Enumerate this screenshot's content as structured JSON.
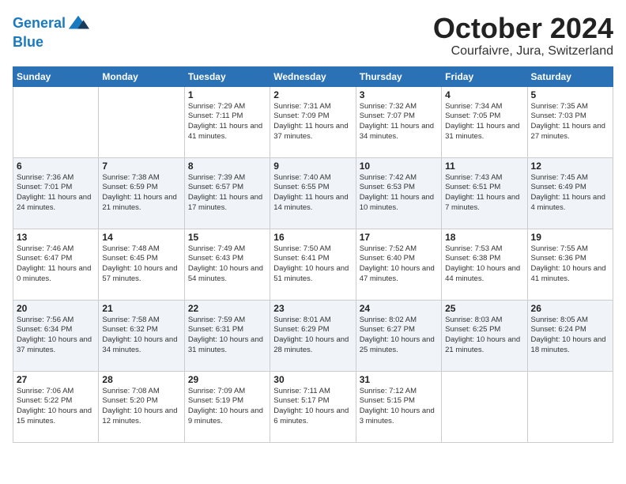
{
  "header": {
    "logo_line1": "General",
    "logo_line2": "Blue",
    "month": "October 2024",
    "location": "Courfaivre, Jura, Switzerland"
  },
  "weekdays": [
    "Sunday",
    "Monday",
    "Tuesday",
    "Wednesday",
    "Thursday",
    "Friday",
    "Saturday"
  ],
  "weeks": [
    [
      {
        "day": "",
        "info": ""
      },
      {
        "day": "",
        "info": ""
      },
      {
        "day": "1",
        "info": "Sunrise: 7:29 AM\nSunset: 7:11 PM\nDaylight: 11 hours and 41 minutes."
      },
      {
        "day": "2",
        "info": "Sunrise: 7:31 AM\nSunset: 7:09 PM\nDaylight: 11 hours and 37 minutes."
      },
      {
        "day": "3",
        "info": "Sunrise: 7:32 AM\nSunset: 7:07 PM\nDaylight: 11 hours and 34 minutes."
      },
      {
        "day": "4",
        "info": "Sunrise: 7:34 AM\nSunset: 7:05 PM\nDaylight: 11 hours and 31 minutes."
      },
      {
        "day": "5",
        "info": "Sunrise: 7:35 AM\nSunset: 7:03 PM\nDaylight: 11 hours and 27 minutes."
      }
    ],
    [
      {
        "day": "6",
        "info": "Sunrise: 7:36 AM\nSunset: 7:01 PM\nDaylight: 11 hours and 24 minutes."
      },
      {
        "day": "7",
        "info": "Sunrise: 7:38 AM\nSunset: 6:59 PM\nDaylight: 11 hours and 21 minutes."
      },
      {
        "day": "8",
        "info": "Sunrise: 7:39 AM\nSunset: 6:57 PM\nDaylight: 11 hours and 17 minutes."
      },
      {
        "day": "9",
        "info": "Sunrise: 7:40 AM\nSunset: 6:55 PM\nDaylight: 11 hours and 14 minutes."
      },
      {
        "day": "10",
        "info": "Sunrise: 7:42 AM\nSunset: 6:53 PM\nDaylight: 11 hours and 10 minutes."
      },
      {
        "day": "11",
        "info": "Sunrise: 7:43 AM\nSunset: 6:51 PM\nDaylight: 11 hours and 7 minutes."
      },
      {
        "day": "12",
        "info": "Sunrise: 7:45 AM\nSunset: 6:49 PM\nDaylight: 11 hours and 4 minutes."
      }
    ],
    [
      {
        "day": "13",
        "info": "Sunrise: 7:46 AM\nSunset: 6:47 PM\nDaylight: 11 hours and 0 minutes."
      },
      {
        "day": "14",
        "info": "Sunrise: 7:48 AM\nSunset: 6:45 PM\nDaylight: 10 hours and 57 minutes."
      },
      {
        "day": "15",
        "info": "Sunrise: 7:49 AM\nSunset: 6:43 PM\nDaylight: 10 hours and 54 minutes."
      },
      {
        "day": "16",
        "info": "Sunrise: 7:50 AM\nSunset: 6:41 PM\nDaylight: 10 hours and 51 minutes."
      },
      {
        "day": "17",
        "info": "Sunrise: 7:52 AM\nSunset: 6:40 PM\nDaylight: 10 hours and 47 minutes."
      },
      {
        "day": "18",
        "info": "Sunrise: 7:53 AM\nSunset: 6:38 PM\nDaylight: 10 hours and 44 minutes."
      },
      {
        "day": "19",
        "info": "Sunrise: 7:55 AM\nSunset: 6:36 PM\nDaylight: 10 hours and 41 minutes."
      }
    ],
    [
      {
        "day": "20",
        "info": "Sunrise: 7:56 AM\nSunset: 6:34 PM\nDaylight: 10 hours and 37 minutes."
      },
      {
        "day": "21",
        "info": "Sunrise: 7:58 AM\nSunset: 6:32 PM\nDaylight: 10 hours and 34 minutes."
      },
      {
        "day": "22",
        "info": "Sunrise: 7:59 AM\nSunset: 6:31 PM\nDaylight: 10 hours and 31 minutes."
      },
      {
        "day": "23",
        "info": "Sunrise: 8:01 AM\nSunset: 6:29 PM\nDaylight: 10 hours and 28 minutes."
      },
      {
        "day": "24",
        "info": "Sunrise: 8:02 AM\nSunset: 6:27 PM\nDaylight: 10 hours and 25 minutes."
      },
      {
        "day": "25",
        "info": "Sunrise: 8:03 AM\nSunset: 6:25 PM\nDaylight: 10 hours and 21 minutes."
      },
      {
        "day": "26",
        "info": "Sunrise: 8:05 AM\nSunset: 6:24 PM\nDaylight: 10 hours and 18 minutes."
      }
    ],
    [
      {
        "day": "27",
        "info": "Sunrise: 7:06 AM\nSunset: 5:22 PM\nDaylight: 10 hours and 15 minutes."
      },
      {
        "day": "28",
        "info": "Sunrise: 7:08 AM\nSunset: 5:20 PM\nDaylight: 10 hours and 12 minutes."
      },
      {
        "day": "29",
        "info": "Sunrise: 7:09 AM\nSunset: 5:19 PM\nDaylight: 10 hours and 9 minutes."
      },
      {
        "day": "30",
        "info": "Sunrise: 7:11 AM\nSunset: 5:17 PM\nDaylight: 10 hours and 6 minutes."
      },
      {
        "day": "31",
        "info": "Sunrise: 7:12 AM\nSunset: 5:15 PM\nDaylight: 10 hours and 3 minutes."
      },
      {
        "day": "",
        "info": ""
      },
      {
        "day": "",
        "info": ""
      }
    ]
  ]
}
